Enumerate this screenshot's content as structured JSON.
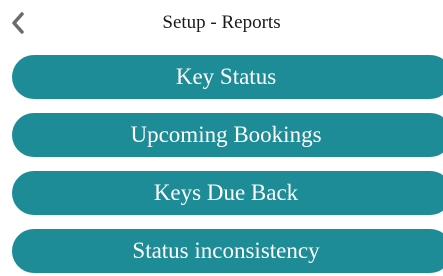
{
  "header": {
    "title": "Setup - Reports",
    "back_icon": "chevron-left-icon"
  },
  "menu": {
    "items": [
      {
        "label": "Key Status"
      },
      {
        "label": "Upcoming Bookings"
      },
      {
        "label": "Keys Due Back"
      },
      {
        "label": "Status inconsistency"
      }
    ]
  },
  "colors": {
    "button_bg": "#1d8c96",
    "button_text": "#ffffff",
    "icon": "#6b6b6b",
    "title_text": "#1a1a1a"
  }
}
